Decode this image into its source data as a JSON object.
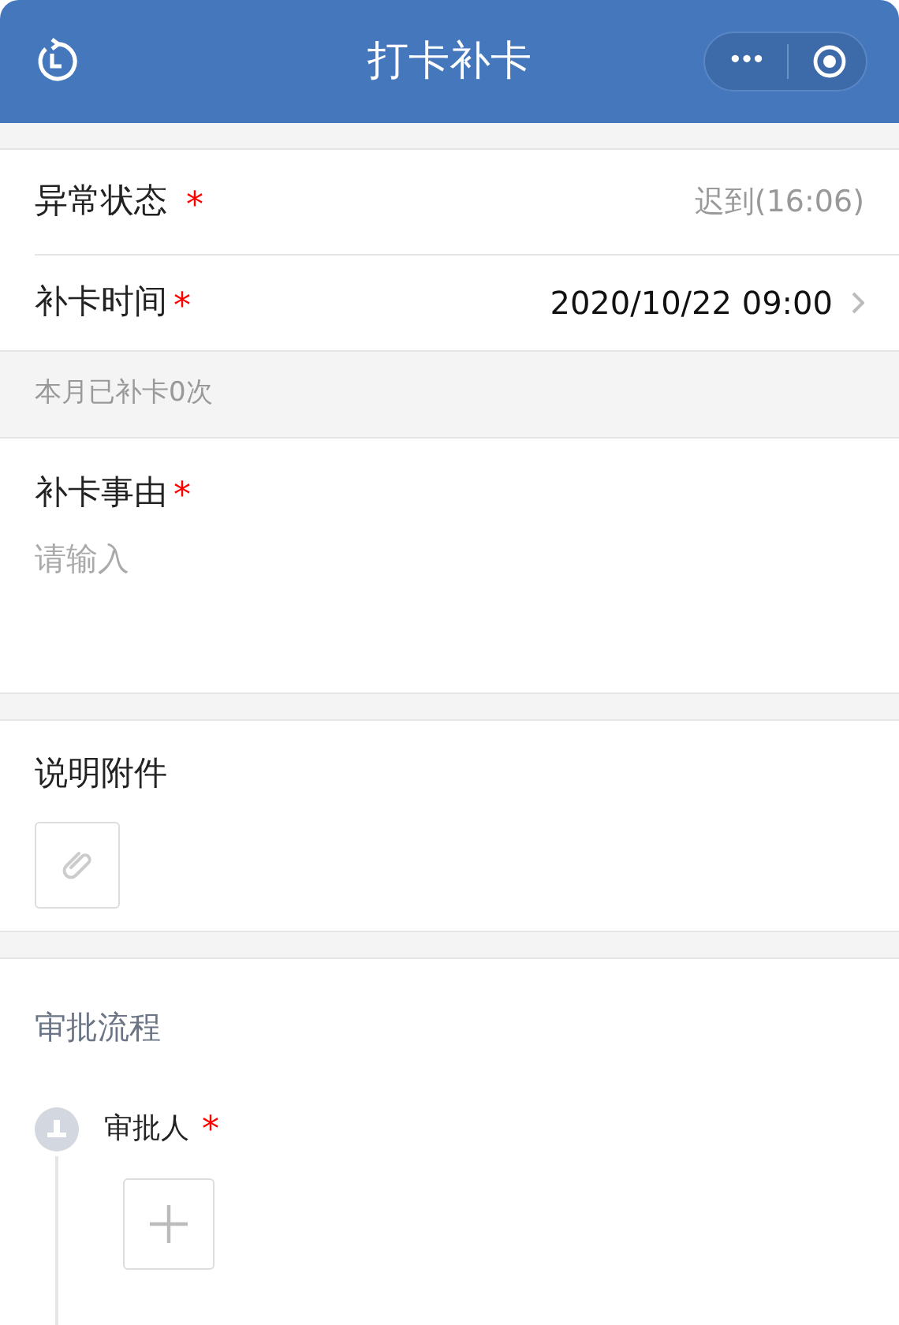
{
  "nav": {
    "title": "打卡补卡",
    "more": "•••"
  },
  "status_row": {
    "label": "异常状态",
    "mark": "*",
    "value": "迟到(16:06)"
  },
  "time_row": {
    "label": "补卡时间",
    "mark": "*",
    "value": "2020/10/22 09:00"
  },
  "note": "本月已补卡0次",
  "reason": {
    "label": "补卡事由",
    "mark": "*",
    "placeholder": "请输入"
  },
  "attachment": {
    "label": "说明附件"
  },
  "approval": {
    "title": "审批流程",
    "approver": {
      "label": "审批人",
      "mark": "*"
    }
  }
}
